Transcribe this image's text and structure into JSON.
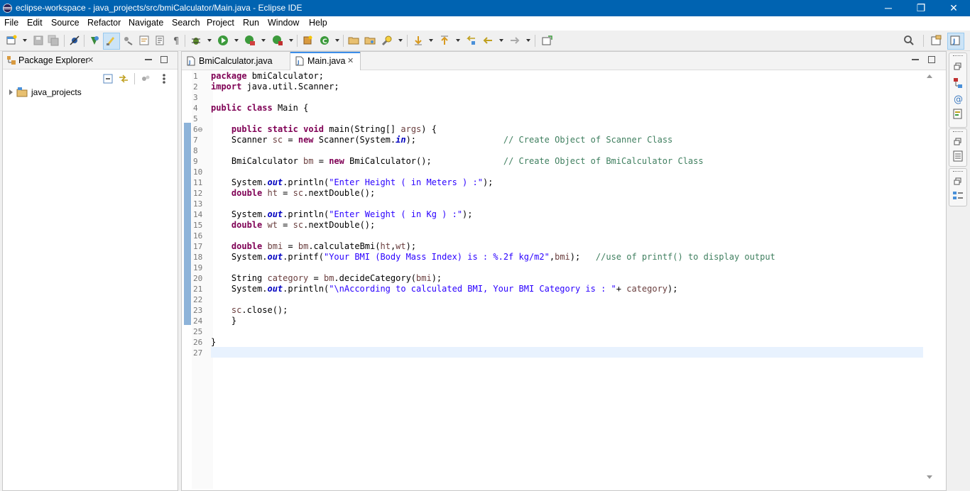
{
  "window": {
    "title": "eclipse-workspace - java_projects/src/bmiCalculator/Main.java - Eclipse IDE",
    "controls": [
      "─",
      "❐",
      "✕"
    ]
  },
  "menu": [
    "File",
    "Edit",
    "Source",
    "Refactor",
    "Navigate",
    "Search",
    "Project",
    "Run",
    "Window",
    "Help"
  ],
  "package_explorer": {
    "title": "Package Explorer",
    "close": "✕",
    "items": [
      {
        "label": "java_projects"
      }
    ]
  },
  "editor": {
    "tabs": [
      {
        "label": "BmiCalculator.java",
        "active": false
      },
      {
        "label": "Main.java",
        "active": true,
        "close": "✕"
      }
    ],
    "lines": [
      {
        "n": "1",
        "tokens": [
          [
            "kw",
            "package"
          ],
          [
            "t",
            " bmiCalculator;"
          ]
        ]
      },
      {
        "n": "2",
        "tokens": [
          [
            "kw",
            "import"
          ],
          [
            "t",
            " java.util.Scanner;"
          ]
        ]
      },
      {
        "n": "3",
        "tokens": []
      },
      {
        "n": "4",
        "tokens": [
          [
            "kw",
            "public"
          ],
          [
            "t",
            " "
          ],
          [
            "kw",
            "class"
          ],
          [
            "t",
            " Main {"
          ]
        ]
      },
      {
        "n": "5",
        "tokens": []
      },
      {
        "n": "6⊖",
        "tokens": [
          [
            "t",
            "    "
          ],
          [
            "kw",
            "public"
          ],
          [
            "t",
            " "
          ],
          [
            "kw",
            "static"
          ],
          [
            "t",
            " "
          ],
          [
            "kw",
            "void"
          ],
          [
            "t",
            " main(String[] "
          ],
          [
            "vr",
            "args"
          ],
          [
            "t",
            ") {"
          ]
        ]
      },
      {
        "n": "7",
        "tokens": [
          [
            "t",
            "    Scanner "
          ],
          [
            "vr",
            "sc"
          ],
          [
            "t",
            " = "
          ],
          [
            "kw",
            "new"
          ],
          [
            "t",
            " Scanner(System."
          ],
          [
            "fld",
            "in"
          ],
          [
            "t",
            ");                 "
          ],
          [
            "com",
            "// Create Object of Scanner Class"
          ]
        ]
      },
      {
        "n": "8",
        "tokens": []
      },
      {
        "n": "9",
        "tokens": [
          [
            "t",
            "    BmiCalculator "
          ],
          [
            "vr",
            "bm"
          ],
          [
            "t",
            " = "
          ],
          [
            "kw",
            "new"
          ],
          [
            "t",
            " BmiCalculator();              "
          ],
          [
            "com",
            "// Create Object of BmiCalculator Class"
          ]
        ]
      },
      {
        "n": "10",
        "tokens": []
      },
      {
        "n": "11",
        "tokens": [
          [
            "t",
            "    System."
          ],
          [
            "fld",
            "out"
          ],
          [
            "t",
            ".println("
          ],
          [
            "str",
            "\"Enter Height ( in Meters ) :\""
          ],
          [
            "t",
            ");"
          ]
        ]
      },
      {
        "n": "12",
        "tokens": [
          [
            "t",
            "    "
          ],
          [
            "kw",
            "double"
          ],
          [
            "t",
            " "
          ],
          [
            "vr",
            "ht"
          ],
          [
            "t",
            " = "
          ],
          [
            "vr",
            "sc"
          ],
          [
            "t",
            ".nextDouble();"
          ]
        ]
      },
      {
        "n": "13",
        "tokens": []
      },
      {
        "n": "14",
        "tokens": [
          [
            "t",
            "    System."
          ],
          [
            "fld",
            "out"
          ],
          [
            "t",
            ".println("
          ],
          [
            "str",
            "\"Enter Weight ( in Kg ) :\""
          ],
          [
            "t",
            ");"
          ]
        ]
      },
      {
        "n": "15",
        "tokens": [
          [
            "t",
            "    "
          ],
          [
            "kw",
            "double"
          ],
          [
            "t",
            " "
          ],
          [
            "vr",
            "wt"
          ],
          [
            "t",
            " = "
          ],
          [
            "vr",
            "sc"
          ],
          [
            "t",
            ".nextDouble();"
          ]
        ]
      },
      {
        "n": "16",
        "tokens": []
      },
      {
        "n": "17",
        "tokens": [
          [
            "t",
            "    "
          ],
          [
            "kw",
            "double"
          ],
          [
            "t",
            " "
          ],
          [
            "vr",
            "bmi"
          ],
          [
            "t",
            " = "
          ],
          [
            "vr",
            "bm"
          ],
          [
            "t",
            ".calculateBmi("
          ],
          [
            "vr",
            "ht"
          ],
          [
            "t",
            ","
          ],
          [
            "vr",
            "wt"
          ],
          [
            "t",
            ");"
          ]
        ]
      },
      {
        "n": "18",
        "tokens": [
          [
            "t",
            "    System."
          ],
          [
            "fld",
            "out"
          ],
          [
            "t",
            ".printf("
          ],
          [
            "str",
            "\"Your BMI (Body Mass Index) is : %.2f kg/m2\""
          ],
          [
            "t",
            ","
          ],
          [
            "vr",
            "bmi"
          ],
          [
            "t",
            ");   "
          ],
          [
            "com",
            "//use of printf() to display output"
          ]
        ]
      },
      {
        "n": "19",
        "tokens": []
      },
      {
        "n": "20",
        "tokens": [
          [
            "t",
            "    String "
          ],
          [
            "vr",
            "category"
          ],
          [
            "t",
            " = "
          ],
          [
            "vr",
            "bm"
          ],
          [
            "t",
            ".decideCategory("
          ],
          [
            "vr",
            "bmi"
          ],
          [
            "t",
            ");"
          ]
        ]
      },
      {
        "n": "21",
        "tokens": [
          [
            "t",
            "    System."
          ],
          [
            "fld",
            "out"
          ],
          [
            "t",
            ".println("
          ],
          [
            "str",
            "\"\\nAccording to calculated BMI, Your BMI Category is : \""
          ],
          [
            "t",
            "+ "
          ],
          [
            "vr",
            "category"
          ],
          [
            "t",
            ");"
          ]
        ]
      },
      {
        "n": "22",
        "tokens": []
      },
      {
        "n": "23",
        "tokens": [
          [
            "t",
            "    "
          ],
          [
            "vr",
            "sc"
          ],
          [
            "t",
            ".close();"
          ]
        ]
      },
      {
        "n": "24",
        "tokens": [
          [
            "t",
            "    }"
          ]
        ]
      },
      {
        "n": "25",
        "tokens": []
      },
      {
        "n": "26",
        "tokens": [
          [
            "t",
            "}"
          ]
        ]
      },
      {
        "n": "27",
        "tokens": []
      }
    ]
  },
  "colors": {
    "titlebar": "#0063b1",
    "keyword": "#7f0055",
    "string": "#2a00ff",
    "comment": "#3f7f5f",
    "field": "#0000c0",
    "variable": "#6a3e3e",
    "current_line": "#e8f2fe",
    "active_tab_accent": "#3d8ee9"
  }
}
